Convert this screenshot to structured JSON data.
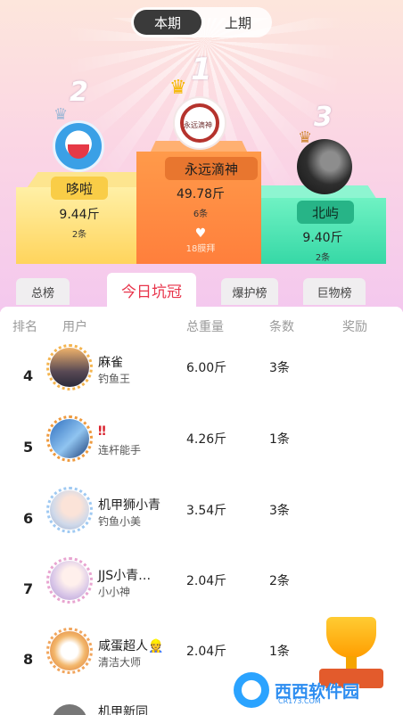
{
  "period_toggle": {
    "current": "本期",
    "previous": "上期"
  },
  "podium": {
    "first": {
      "rank": "1",
      "name": "永远滴神",
      "weight": "49.78斤",
      "count": "6条",
      "likes": "18膜拜",
      "avatar_text": "永远滴神"
    },
    "second": {
      "rank": "2",
      "name": "哆啦",
      "weight": "9.44斤",
      "count": "2条"
    },
    "third": {
      "rank": "3",
      "name": "北屿",
      "weight": "9.40斤",
      "count": "2条"
    }
  },
  "tabs": [
    "总榜",
    "今日坑冠",
    "爆护榜",
    "巨物榜"
  ],
  "columns": {
    "rank": "排名",
    "user": "用户",
    "weight": "总重量",
    "count": "条数",
    "reward": "奖励"
  },
  "rows": [
    {
      "rank": "4",
      "name": "麻雀",
      "title": "钓鱼王",
      "weight": "6.00斤",
      "count": "3条"
    },
    {
      "rank": "5",
      "name": "‼",
      "title": "连杆能手",
      "weight": "4.26斤",
      "count": "1条"
    },
    {
      "rank": "6",
      "name": "机甲狮小青",
      "title": "钓鱼小美",
      "weight": "3.54斤",
      "count": "3条"
    },
    {
      "rank": "7",
      "name": "JJS小青…",
      "title": "小小神",
      "weight": "2.04斤",
      "count": "2条"
    },
    {
      "rank": "8",
      "name": "咸蛋超人👷",
      "title": "清洁大师",
      "weight": "2.04斤",
      "count": "1条"
    }
  ],
  "partial_row": {
    "name": "机甲新同"
  },
  "watermark": {
    "brand": "西西软件园",
    "domain": "CR173.COM"
  },
  "colors": {
    "accent": "#e8344b",
    "gold": "#ffd45c",
    "orange": "#ff7f3c",
    "green": "#36d8a6"
  }
}
